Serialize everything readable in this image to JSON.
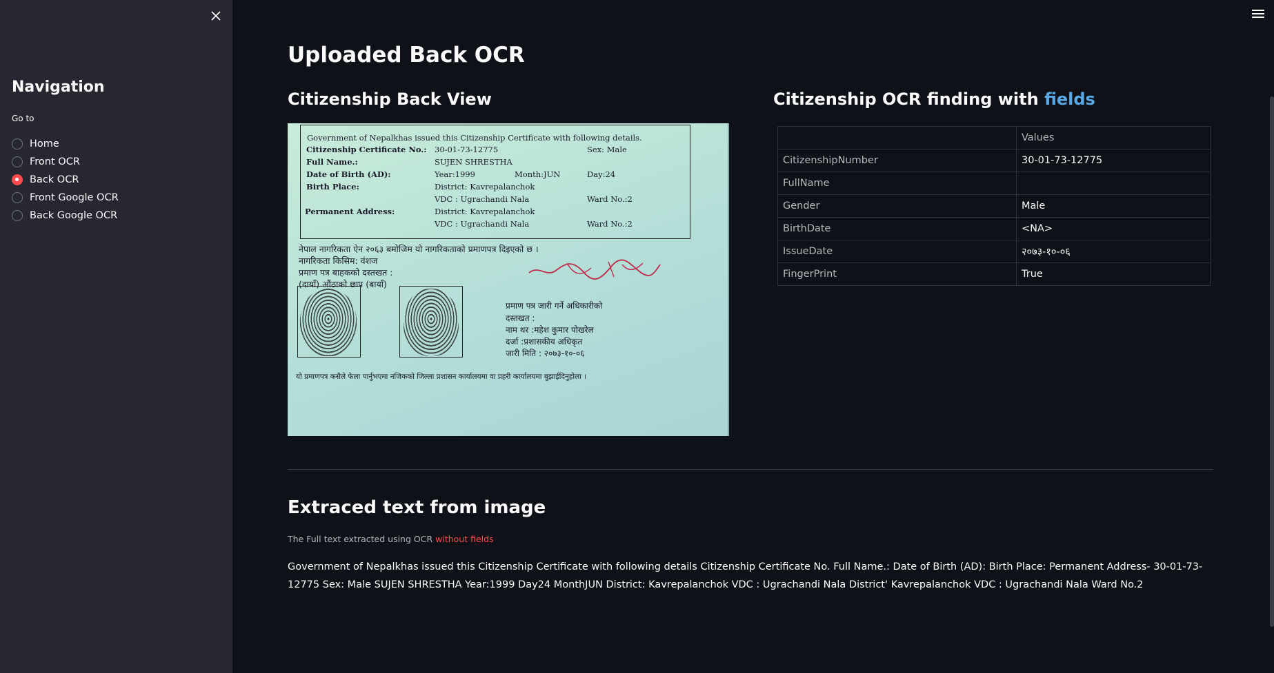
{
  "sidebar": {
    "title": "Navigation",
    "goto_label": "Go to",
    "options": [
      {
        "label": "Home",
        "selected": false
      },
      {
        "label": "Front OCR",
        "selected": false
      },
      {
        "label": "Back OCR",
        "selected": true
      },
      {
        "label": "Front Google OCR",
        "selected": false
      },
      {
        "label": "Back Google OCR",
        "selected": false
      }
    ]
  },
  "main": {
    "page_title": "Uploaded Back OCR",
    "left_heading": "Citizenship Back View",
    "right_heading_prefix": "Citizenship OCR finding with ",
    "right_heading_accent": "fields",
    "table": {
      "header": [
        "",
        "Values"
      ],
      "rows": [
        {
          "key": "CitizenshipNumber",
          "value": "30-01-73-12775"
        },
        {
          "key": "FullName",
          "value": ""
        },
        {
          "key": "Gender",
          "value": "Male"
        },
        {
          "key": "BirthDate",
          "value": "<NA>"
        },
        {
          "key": "IssueDate",
          "value": "२०७३-१०-०६"
        },
        {
          "key": "FingerPrint",
          "value": "True"
        }
      ]
    },
    "extracted_heading": "Extraced text from image",
    "caption_prefix": "The Full text extracted using OCR ",
    "caption_accent": "without fields",
    "extracted_text": "Government of Nepalkhas issued this Citizenship Certificate with following details Citizenship Certificate No. Full Name.: Date of Birth (AD): Birth Place: Permanent Address- 30-01-73-12775 Sex: Male SUJEN SHRESTHA Year:1999 Day24 MonthJUN District: Kavrepalanchok VDC : Ugrachandi Nala District' Kavrepalanchok VDC : Ugrachandi Nala Ward No.2"
  },
  "certificate_image": {
    "line1": "Government of Nepalkhas issued this Citizenship Certificate with following details.",
    "cert_no_label": "Citizenship Certificate No.:",
    "cert_no": "30-01-73-12775",
    "sex": "Sex: Male",
    "name_label": "Full Name.:",
    "name": "SUJEN SHRESTHA",
    "dob_label": "Date of Birth (AD):",
    "year": "Year:1999",
    "month": "Month:JUN",
    "day": "Day:24",
    "birth_place_label": "Birth Place:",
    "district1": "District: Kavrepalanchok",
    "vdc1": "VDC : Ugrachandi Nala",
    "ward1": "Ward No.:2",
    "perm_label": "Permanent Address:",
    "district2": "District: Kavrepalanchok",
    "vdc2": "VDC : Ugrachandi Nala",
    "ward2": "Ward No.:2",
    "dev1": "नेपाल नागरिकता ऐन २०६३ बमोजिम यो नागरिकताको प्रमाणपत्र दिइएको छ ।",
    "dev2": "नागरिकता किसिम: वंशज",
    "dev3": "प्रमाण पत्र बाहकको दस्तखत :",
    "dev4": "(दायाँ)   औंठाको छाप   (बायाँ)",
    "dev5": "प्रमाण पत्र जारी गर्ने अधिकारीको",
    "dev6": "दस्तखत :",
    "dev7": "नाम थर :महेश कुमार पोखरेल",
    "dev8": "दर्जा :प्रशासकीय अधिकृत",
    "dev9": "जारी मिति : २०७३-१०-०६",
    "dev10": "यो प्रमाणपत्र कसैले फेला पार्नुभएमा नजिकको जिल्ला प्रशासन कार्यालयमा वा प्रहरी कार्यालयमा बुझाईदिनुहोला ।"
  }
}
